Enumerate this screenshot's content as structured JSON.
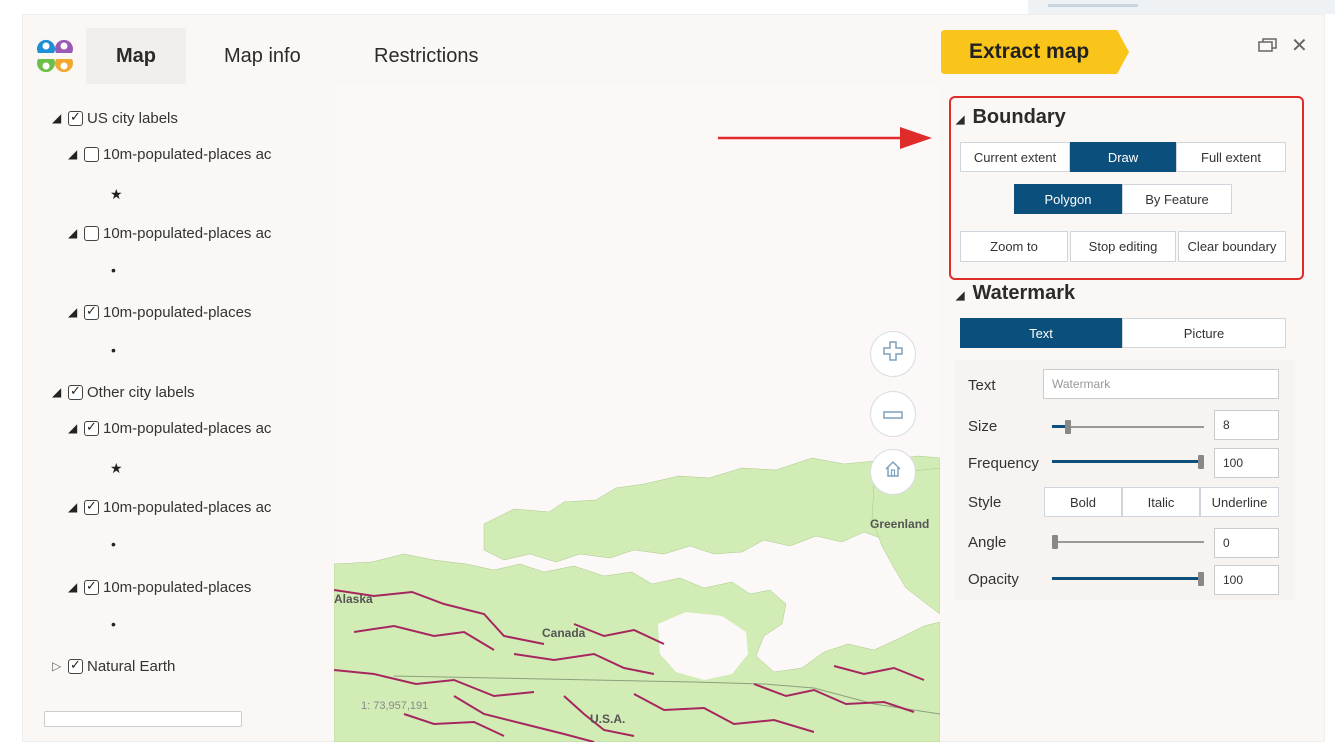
{
  "tabs": [
    {
      "label": "Map"
    },
    {
      "label": "Map info"
    },
    {
      "label": "Restrictions"
    }
  ],
  "extract_button": "Extract map",
  "layers": [
    {
      "label": "US city labels",
      "checked": true
    },
    {
      "label": "10m-populated-places ac",
      "checked": false
    },
    {
      "label": "10m-populated-places ac",
      "checked": false
    },
    {
      "label": "10m-populated-places",
      "checked": true
    },
    {
      "label": "Other city labels",
      "checked": true
    },
    {
      "label": "10m-populated-places ac",
      "checked": true
    },
    {
      "label": "10m-populated-places ac",
      "checked": true
    },
    {
      "label": "10m-populated-places",
      "checked": true
    },
    {
      "label": "Natural Earth",
      "checked": true
    }
  ],
  "map": {
    "scale": "1: 73,957,191",
    "labels": {
      "alaska": "Alaska",
      "canada": "Canada",
      "usa": "U.S.A.",
      "greenland": "Greenland"
    },
    "icons": {
      "zoom_in": "plus-icon",
      "zoom_out": "minus-icon",
      "home": "home-icon"
    }
  },
  "boundary": {
    "title": "Boundary",
    "extent_buttons": [
      "Current extent",
      "Draw",
      "Full extent"
    ],
    "extent_selected": "Draw",
    "draw_buttons": [
      "Polygon",
      "By Feature"
    ],
    "draw_selected": "Polygon",
    "action_buttons": [
      "Zoom to",
      "Stop editing",
      "Clear boundary"
    ]
  },
  "watermark": {
    "title": "Watermark",
    "type_buttons": [
      "Text",
      "Picture"
    ],
    "type_selected": "Text",
    "text_label": "Text",
    "text_placeholder": "Watermark",
    "size_label": "Size",
    "size_value": "8",
    "size_fraction": 0.09,
    "frequency_label": "Frequency",
    "frequency_value": "100",
    "frequency_fraction": 1.0,
    "style_label": "Style",
    "style_buttons": [
      "Bold",
      "Italic",
      "Underline"
    ],
    "angle_label": "Angle",
    "angle_value": "0",
    "angle_fraction": 0.0,
    "opacity_label": "Opacity",
    "opacity_value": "100",
    "opacity_fraction": 1.0
  },
  "colors": {
    "accent": "#0b4f7c",
    "extract_button": "#f9c51a",
    "highlight_border": "#e02b2b",
    "land": "#d2ecb6",
    "rivers": "#a5275e"
  }
}
